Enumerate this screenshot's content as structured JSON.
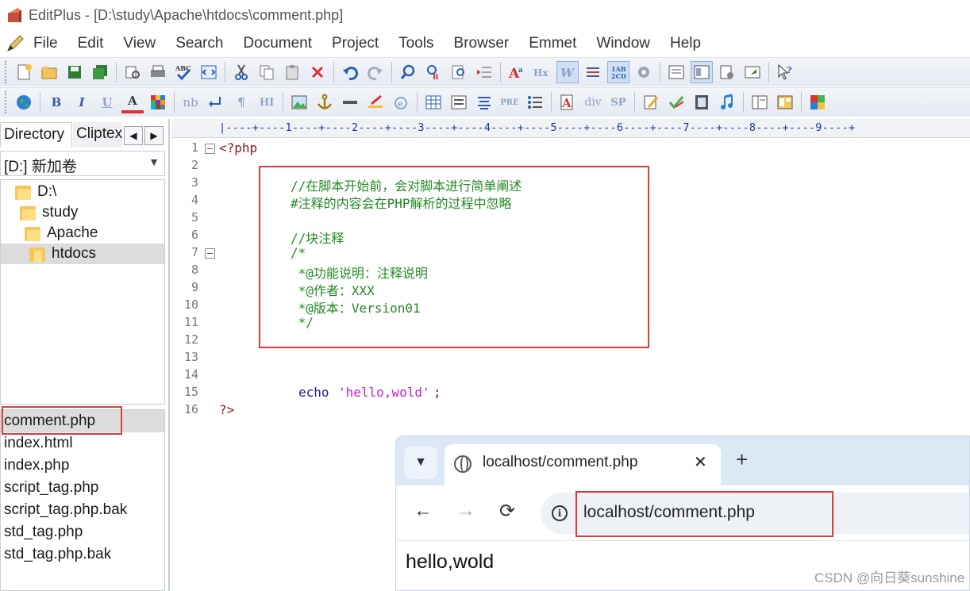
{
  "window": {
    "title": "EditPlus - [D:\\study\\Apache\\htdocs\\comment.php]"
  },
  "menu": [
    "File",
    "Edit",
    "View",
    "Search",
    "Document",
    "Project",
    "Tools",
    "Browser",
    "Emmet",
    "Window",
    "Help"
  ],
  "toolbar2_text": {
    "bold": "B",
    "italic": "I",
    "underline": "U",
    "font_color": "A",
    "nbsp": "nb",
    "paragraph": "¶",
    "heading": "HI",
    "pre": "PRE",
    "div": "div",
    "span": "SP"
  },
  "sidebar": {
    "tabs": [
      "Directory",
      "Cliptext"
    ],
    "drive": "[D:] 新加卷",
    "tree": [
      "D:\\",
      "study",
      "Apache",
      "htdocs"
    ],
    "selected_folder": "htdocs",
    "files": [
      "comment.php",
      "index.html",
      "index.php",
      "script_tag.php",
      "script_tag.php.bak",
      "std_tag.php",
      "std_tag.php.bak"
    ],
    "selected_file": "comment.php"
  },
  "ruler": "|----+----1----+----2----+----3----+----4----+----5----+----6----+----7----+----8----+----9----+",
  "editor": {
    "line_numbers": [
      "1",
      "2",
      "3",
      "4",
      "5",
      "6",
      "7",
      "8",
      "9",
      "10",
      "11",
      "12",
      "13",
      "14",
      "15",
      "16"
    ],
    "lines": {
      "l1": "<?php",
      "l3": "//在脚本开始前，会对脚本进行简单阐述",
      "l4": "#注释的内容会在PHP解析的过程中忽略",
      "l6": "//块注释",
      "l7": "/*",
      "l8": " *@功能说明：注释说明",
      "l9": " *@作者：XXX",
      "l10": " *@版本：Version01",
      "l11": " */",
      "l15_kw": "echo",
      "l15_str": "'hello,wold'",
      "l15_end": ";",
      "l16": "?>"
    }
  },
  "browser": {
    "tab_title": "localhost/comment.php",
    "close": "✕",
    "new_tab": "+",
    "url": "localhost/comment.php",
    "content": "hello,wold"
  },
  "watermark": "CSDN @向日葵sunshine",
  "colors": {
    "accent_red": "#e03a3a",
    "comment_green": "#228b22",
    "string_magenta": "#d01ad0",
    "keyword_blue": "#1a1aa0"
  }
}
